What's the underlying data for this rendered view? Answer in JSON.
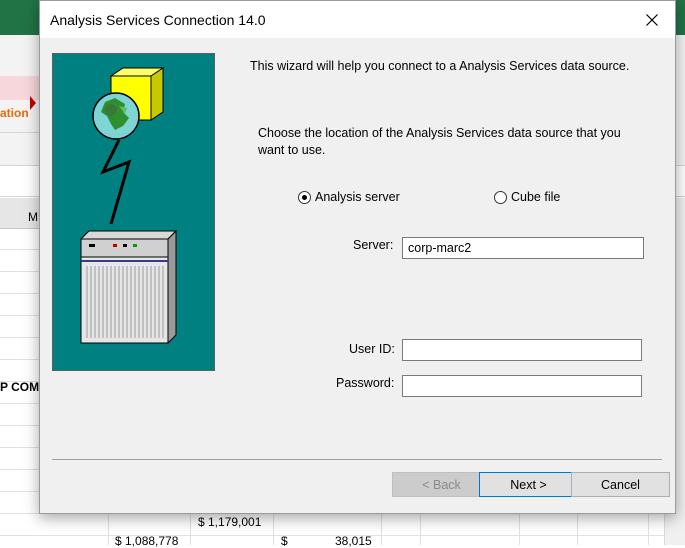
{
  "background": {
    "tab_fragment": "ation",
    "col_head": "M",
    "bold_row": "P COM",
    "values": [
      "$ 1,179,001",
      "$ 1,088,778",
      "$",
      "38,015"
    ]
  },
  "dialog": {
    "title": "Analysis Services Connection 14.0",
    "intro": "This wizard will help you connect to a Analysis Services data source.",
    "choose_line1": "Choose the location of the Analysis Services data source that you",
    "choose_line2": "want to use.",
    "options": {
      "analysis_server": "Analysis server",
      "cube_file": "Cube file",
      "selected": "analysis_server"
    },
    "server_label": "Server:",
    "server_value": "corp-marc2",
    "user_label": "User ID:",
    "user_value": "",
    "password_label": "Password:",
    "password_value": "",
    "buttons": {
      "back": "< Back",
      "next": "Next >",
      "cancel": "Cancel"
    }
  },
  "colors": {
    "art_bg": "#008080",
    "excel_green": "#217346",
    "focus_blue": "#0078d7"
  }
}
